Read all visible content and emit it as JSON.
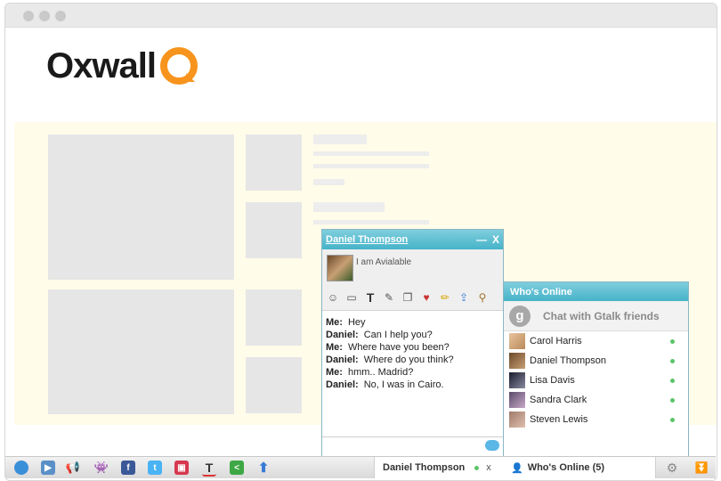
{
  "app": {
    "logo_text": "Oxwall"
  },
  "chat": {
    "contact_name": "Daniel Thompson",
    "minimize_glyph": "—",
    "close_glyph": "X",
    "status_message": "I am Avialable",
    "messages": [
      {
        "sender": "Me:",
        "text": "Hey"
      },
      {
        "sender": "Daniel:",
        "text": "Can I help you?"
      },
      {
        "sender": "Me:",
        "text": "Where have you been?"
      },
      {
        "sender": "Daniel:",
        "text": "Where do you think?"
      },
      {
        "sender": "Me:",
        "text": "hmm.. Madrid?"
      },
      {
        "sender": "Daniel:",
        "text": "No, I was in Cairo."
      }
    ],
    "tools": [
      "smiley-icon",
      "monitor-icon",
      "text-format-icon",
      "note-icon",
      "copy-icon",
      "card-icon",
      "pencil-icon",
      "upload-icon",
      "broom-icon"
    ]
  },
  "online": {
    "title": "Who's Online",
    "gtalk_label": "Chat with Gtalk friends",
    "users": [
      {
        "name": "Carol Harris",
        "status": "online"
      },
      {
        "name": "Daniel Thompson",
        "status": "online"
      },
      {
        "name": "Lisa Davis",
        "status": "online"
      },
      {
        "name": "Sandra Clark",
        "status": "online"
      },
      {
        "name": "Steven Lewis",
        "status": "online"
      }
    ]
  },
  "bottombar": {
    "chat_tab_label": "Daniel Thompson",
    "chat_tab_close": "x",
    "online_tab_label": "Who's Online (5)"
  },
  "colors": {
    "accent": "#46b3c8",
    "online": "#5cc46b",
    "logo_orange": "#f7941d"
  }
}
